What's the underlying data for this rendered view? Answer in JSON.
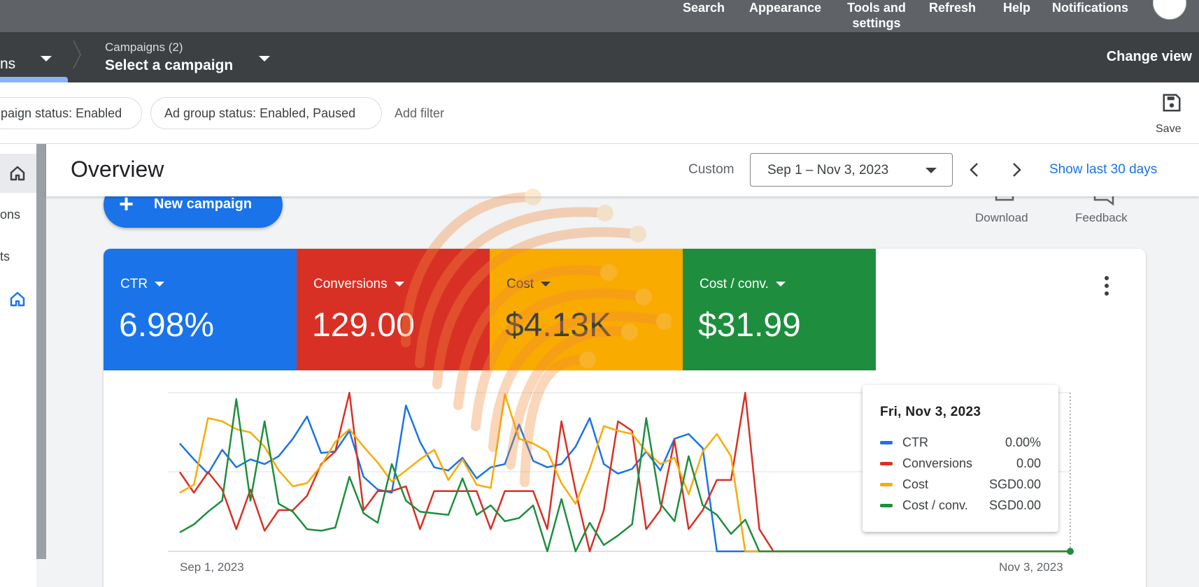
{
  "topnav": {
    "search": "Search",
    "appearance": "Appearance",
    "tools_line1": "Tools and",
    "tools_line2": "settings",
    "refresh": "Refresh",
    "help": "Help",
    "notifications": "Notifications"
  },
  "breadcrumb": {
    "left_label": "ns",
    "campaigns_count": "Campaigns (2)",
    "campaign_select": "Select a campaign",
    "change_view": "Change view"
  },
  "filters": {
    "chips": [
      "paign status: Enabled",
      "Ad group status: Enabled, Paused"
    ],
    "add_filter": "Add filter",
    "save": "Save"
  },
  "rail": {
    "items": [
      "ons",
      "ts"
    ]
  },
  "overview": {
    "title": "Overview",
    "custom_label": "Custom",
    "date_range": "Sep 1 – Nov 3, 2023",
    "show_last": "Show last 30 days",
    "new_campaign": "New campaign",
    "download": "Download",
    "feedback": "Feedback"
  },
  "tiles": [
    {
      "label": "CTR",
      "value": "6.98%",
      "color": "#1a73e8"
    },
    {
      "label": "Conversions",
      "value": "129.00",
      "color": "#d93025"
    },
    {
      "label": "Cost",
      "value": "$4.13K",
      "color": "#f9ab00"
    },
    {
      "label": "Cost / conv.",
      "value": "$31.99",
      "color": "#1e8e3e"
    }
  ],
  "tooltip": {
    "date": "Fri, Nov 3, 2023",
    "rows": [
      {
        "name": "CTR",
        "value": "0.00%",
        "color": "#1a73e8"
      },
      {
        "name": "Conversions",
        "value": "0.00",
        "color": "#d93025"
      },
      {
        "name": "Cost",
        "value": "SGD0.00",
        "color": "#f9ab00"
      },
      {
        "name": "Cost / conv.",
        "value": "SGD0.00",
        "color": "#1e8e3e"
      }
    ]
  },
  "chart_data": {
    "type": "line",
    "x_start": "Sep 1, 2023",
    "x_end": "Nov 3, 2023",
    "ylim": [
      0,
      1
    ],
    "grid": true,
    "series": [
      {
        "name": "CTR",
        "color": "#1a73e8",
        "values": [
          0.68,
          0.58,
          0.49,
          0.64,
          0.53,
          0.58,
          0.55,
          0.6,
          0.71,
          0.85,
          0.62,
          0.63,
          0.76,
          0.47,
          0.39,
          0.37,
          0.92,
          0.69,
          0.53,
          0.51,
          0.59,
          0.46,
          0.53,
          0.55,
          0.8,
          0.57,
          0.53,
          0.55,
          0.66,
          0.84,
          0.55,
          0.49,
          0.52,
          0.63,
          0.51,
          0.71,
          0.74,
          0.65,
          0.0,
          0.0,
          0.0,
          0.0,
          0.0,
          0.0,
          0.0,
          0.0,
          0.0,
          0.0,
          0.0,
          0.0,
          0.0,
          0.0,
          0.0,
          0.0,
          0.0,
          0.0,
          0.0,
          0.0,
          0.0,
          0.0,
          0.0,
          0.0,
          0.0,
          0.0
        ]
      },
      {
        "name": "Conversions",
        "color": "#d93025",
        "values": [
          0.5,
          0.37,
          0.5,
          0.39,
          0.14,
          0.39,
          0.13,
          0.26,
          0.26,
          0.35,
          0.55,
          0.63,
          1.0,
          0.26,
          0.38,
          0.38,
          0.41,
          0.14,
          0.38,
          0.38,
          0.38,
          0.38,
          0.14,
          0.38,
          0.38,
          0.38,
          0.14,
          0.82,
          0.38,
          0.0,
          0.26,
          0.82,
          0.76,
          0.14,
          0.26,
          0.7,
          0.14,
          0.26,
          0.45,
          0.45,
          1.0,
          0.14,
          0.0,
          0.0,
          0.0,
          0.0,
          0.0,
          0.0,
          0.0,
          0.0,
          0.0,
          0.0,
          0.0,
          0.0,
          0.0,
          0.0,
          0.0,
          0.0,
          0.0,
          0.0,
          0.0,
          0.0,
          0.0,
          0.0
        ]
      },
      {
        "name": "Cost",
        "color": "#f9ab00",
        "values": [
          0.37,
          0.42,
          0.84,
          0.82,
          0.77,
          0.75,
          0.66,
          0.51,
          0.41,
          0.43,
          0.54,
          0.69,
          0.77,
          0.66,
          0.56,
          0.44,
          0.51,
          0.58,
          0.64,
          0.45,
          0.58,
          0.42,
          0.4,
          0.99,
          0.71,
          0.68,
          0.63,
          0.43,
          0.3,
          0.52,
          0.79,
          0.76,
          0.74,
          0.63,
          0.55,
          0.59,
          0.36,
          0.63,
          0.74,
          0.6,
          0.0,
          0.0,
          0.0,
          0.0,
          0.0,
          0.0,
          0.0,
          0.0,
          0.0,
          0.0,
          0.0,
          0.0,
          0.0,
          0.0,
          0.0,
          0.0,
          0.0,
          0.0,
          0.0,
          0.0,
          0.0,
          0.0,
          0.0,
          0.0
        ]
      },
      {
        "name": "Cost / conv.",
        "color": "#1e8e3e",
        "values": [
          0.12,
          0.17,
          0.25,
          0.32,
          0.96,
          0.32,
          0.82,
          0.3,
          0.25,
          0.14,
          0.13,
          0.15,
          0.47,
          0.24,
          0.18,
          0.55,
          0.32,
          0.25,
          0.24,
          0.23,
          0.46,
          0.23,
          0.29,
          0.19,
          0.21,
          0.29,
          0.0,
          0.33,
          0.0,
          0.18,
          0.04,
          0.1,
          0.17,
          0.84,
          0.3,
          0.19,
          0.6,
          0.29,
          0.23,
          0.11,
          0.2,
          0.0,
          0.0,
          0.0,
          0.0,
          0.0,
          0.0,
          0.0,
          0.0,
          0.0,
          0.0,
          0.0,
          0.0,
          0.0,
          0.0,
          0.0,
          0.0,
          0.0,
          0.0,
          0.0,
          0.0,
          0.0,
          0.0,
          0.0
        ]
      }
    ]
  }
}
